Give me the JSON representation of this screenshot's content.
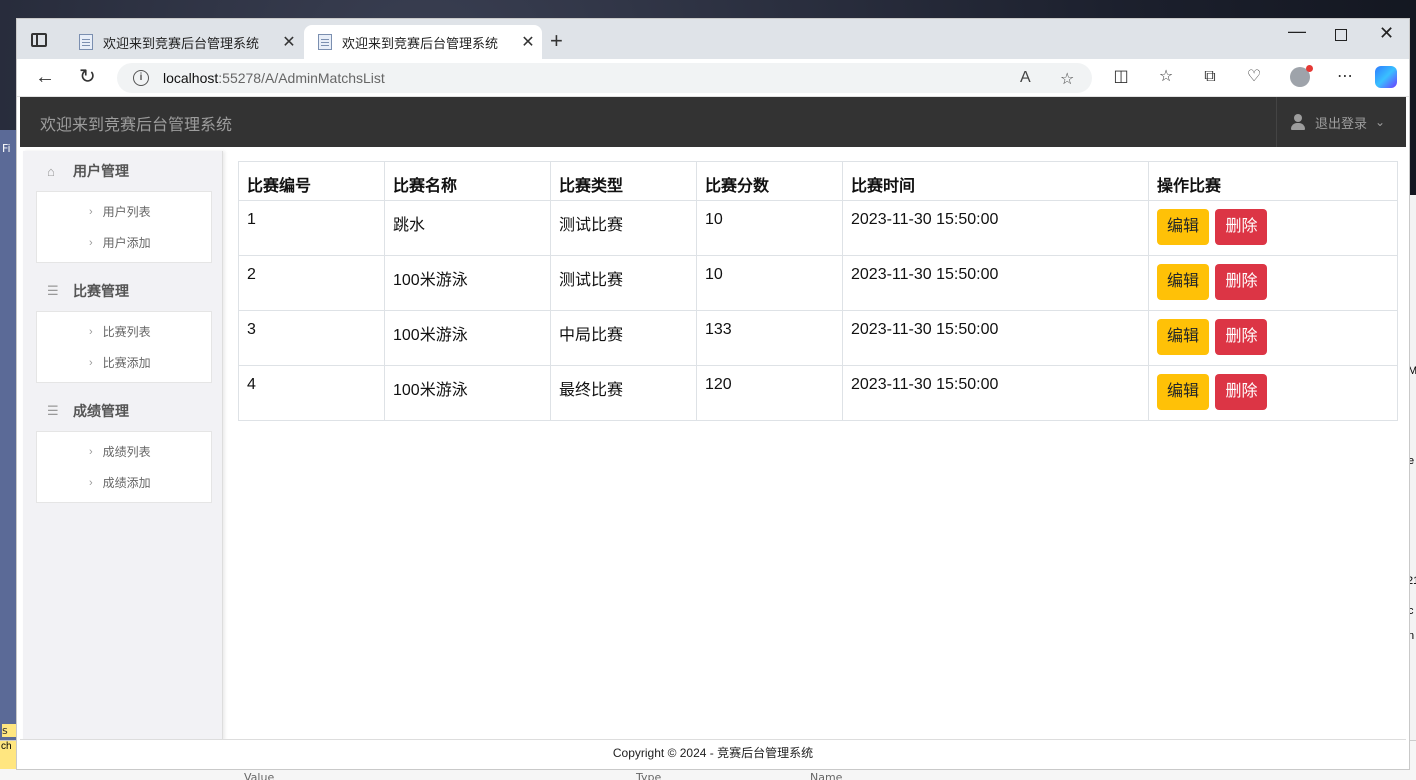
{
  "browser": {
    "tabs": [
      {
        "title": "欢迎来到竞赛后台管理系统",
        "active": false
      },
      {
        "title": "欢迎来到竞赛后台管理系统",
        "active": true
      }
    ],
    "url_host": "localhost",
    "url_path": ":55278/A/AdminMatchsList"
  },
  "header": {
    "title": "欢迎来到竞赛后台管理系统",
    "logout_label": "退出登录"
  },
  "sidebar": {
    "groups": [
      {
        "label": "用户管理",
        "icon": "home-icon",
        "items": [
          "用户列表",
          "用户添加"
        ]
      },
      {
        "label": "比赛管理",
        "icon": "list-icon",
        "items": [
          "比赛列表",
          "比赛添加"
        ]
      },
      {
        "label": "成绩管理",
        "icon": "list-icon",
        "items": [
          "成绩列表",
          "成绩添加"
        ]
      }
    ]
  },
  "table": {
    "headers": [
      "比赛编号",
      "比赛名称",
      "比赛类型",
      "比赛分数",
      "比赛时间",
      "操作比赛"
    ],
    "rows": [
      {
        "id": "1",
        "name": "跳水",
        "type": "测试比赛",
        "score": "10",
        "time": "2023-11-30 15:50:00"
      },
      {
        "id": "2",
        "name": "100米游泳",
        "type": "测试比赛",
        "score": "10",
        "time": "2023-11-30 15:50:00"
      },
      {
        "id": "3",
        "name": "100米游泳",
        "type": "中局比赛",
        "score": "133",
        "time": "2023-11-30 15:50:00"
      },
      {
        "id": "4",
        "name": "100米游泳",
        "type": "最终比赛",
        "score": "120",
        "time": "2023-11-30 15:50:00"
      }
    ],
    "edit_label": "编辑",
    "delete_label": "删除"
  },
  "footer": {
    "text": "Copyright © 2024 - 竞赛后台管理系统"
  },
  "desktop": {
    "left_fragments": [
      "Fi",
      "s",
      "ch"
    ],
    "right_fragments": [
      "e",
      "M",
      "e",
      "21",
      "c",
      "n"
    ],
    "bottom_columns": [
      "Value",
      "Type",
      "Name"
    ]
  },
  "colors": {
    "header_bg": "#333333",
    "edit_button": "#ffc107",
    "delete_button": "#dc3545"
  }
}
